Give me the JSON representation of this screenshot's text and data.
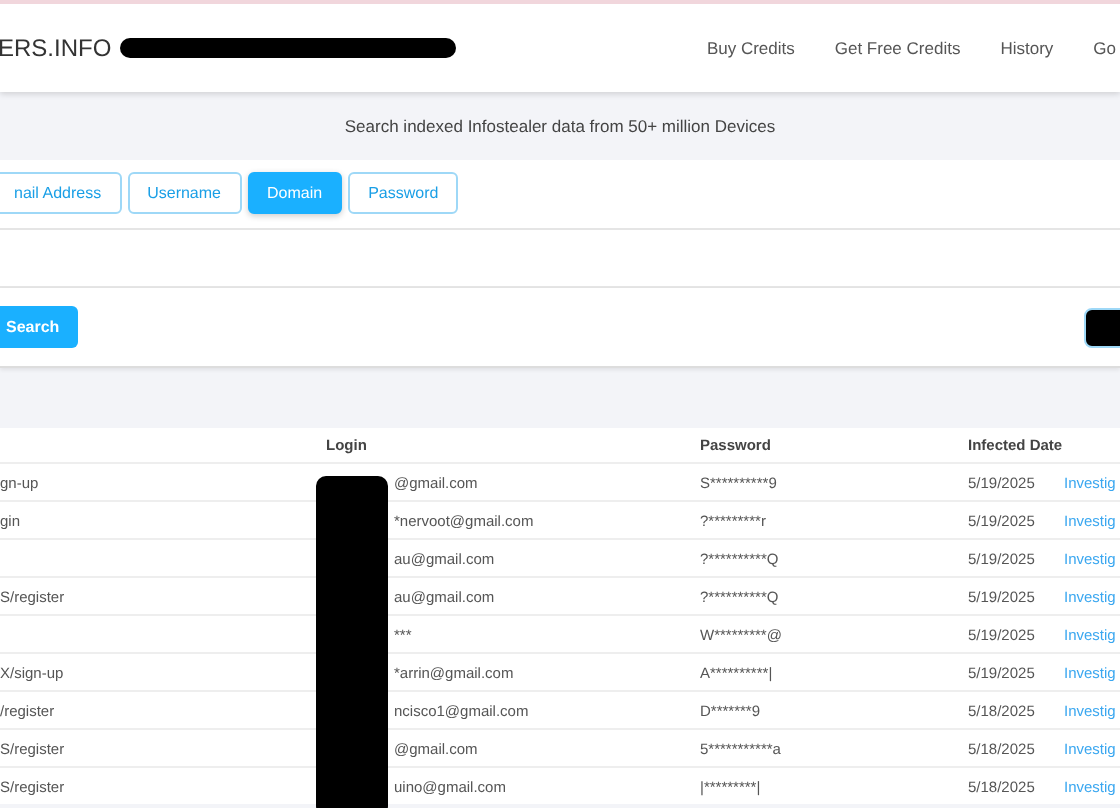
{
  "header": {
    "logo": "ERS.INFO",
    "nav": [
      "Buy Credits",
      "Get Free Credits",
      "History",
      "Go"
    ]
  },
  "subtitle": "Search indexed Infostealer data from 50+ million Devices",
  "tabs": [
    {
      "label": "nail Address",
      "selected": false
    },
    {
      "label": "Username",
      "selected": false
    },
    {
      "label": "Domain",
      "selected": true
    },
    {
      "label": "Password",
      "selected": false
    }
  ],
  "search_button": "Search",
  "table": {
    "columns": [
      "Login",
      "Password",
      "Infected Date"
    ],
    "rows": [
      {
        "url": "gn-up",
        "login": "@gmail.com",
        "password": "S**********9",
        "date": "5/19/2025",
        "action": "Investig"
      },
      {
        "url": "gin",
        "login": "*nervoot@gmail.com",
        "password": "?*********r",
        "date": "5/19/2025",
        "action": "Investig"
      },
      {
        "url": "",
        "login": "au@gmail.com",
        "password": "?**********Q",
        "date": "5/19/2025",
        "action": "Investig"
      },
      {
        "url": "S/register",
        "login": "au@gmail.com",
        "password": "?**********Q",
        "date": "5/19/2025",
        "action": "Investig"
      },
      {
        "url": "",
        "login": "***",
        "password": "W*********@",
        "date": "5/19/2025",
        "action": "Investig"
      },
      {
        "url": "X/sign-up",
        "login": "*arrin@gmail.com",
        "password": "A**********|",
        "date": "5/19/2025",
        "action": "Investig"
      },
      {
        "url": "/register",
        "login": "ncisco1@gmail.com",
        "password": "D*******9",
        "date": "5/18/2025",
        "action": "Investig"
      },
      {
        "url": "S/register",
        "login": "@gmail.com",
        "password": "5***********a",
        "date": "5/18/2025",
        "action": "Investig"
      },
      {
        "url": "S/register",
        "login": "uino@gmail.com",
        "password": "|*********|",
        "date": "5/18/2025",
        "action": "Investig"
      }
    ]
  }
}
